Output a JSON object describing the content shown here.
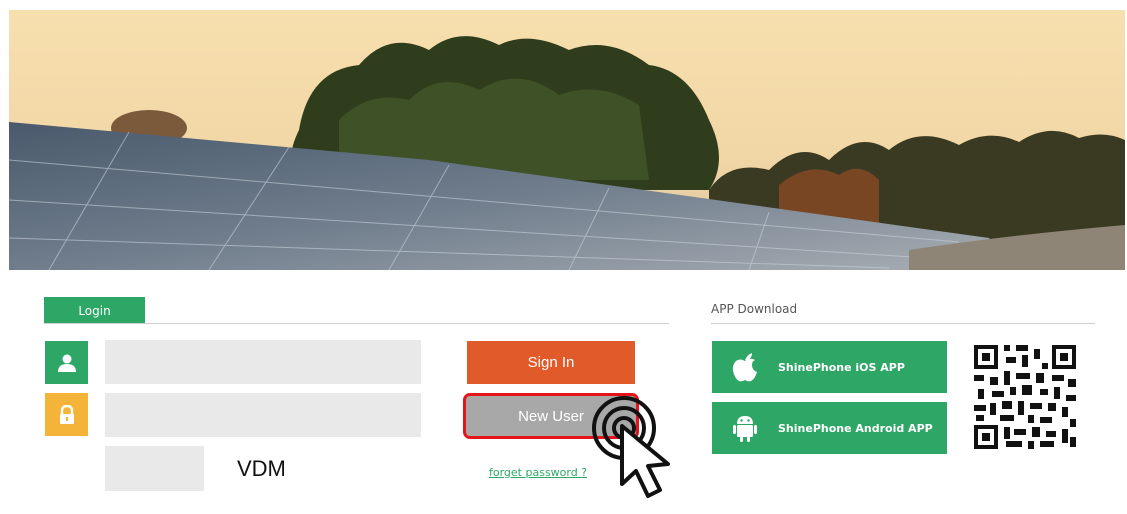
{
  "login": {
    "tab_label": "Login",
    "username": {
      "value": "",
      "placeholder": ""
    },
    "password": {
      "value": "",
      "placeholder": ""
    },
    "captcha": {
      "value": "",
      "code_text": "VDM"
    },
    "sign_in_label": "Sign In",
    "new_user_label": "New User",
    "forget_password_label": "forget password ?"
  },
  "app_download": {
    "title": "APP Download",
    "ios_label": "ShinePhone iOS APP",
    "android_label": "ShinePhone Android APP"
  },
  "colors": {
    "brand_green": "#2ea766",
    "sign_in_orange": "#e05a2a",
    "lock_yellow": "#f4b43a",
    "highlight_red": "#e3151a"
  },
  "icons": [
    "user-icon",
    "lock-icon",
    "apple-icon",
    "android-icon",
    "qr-code",
    "pointer-cursor-icon"
  ]
}
